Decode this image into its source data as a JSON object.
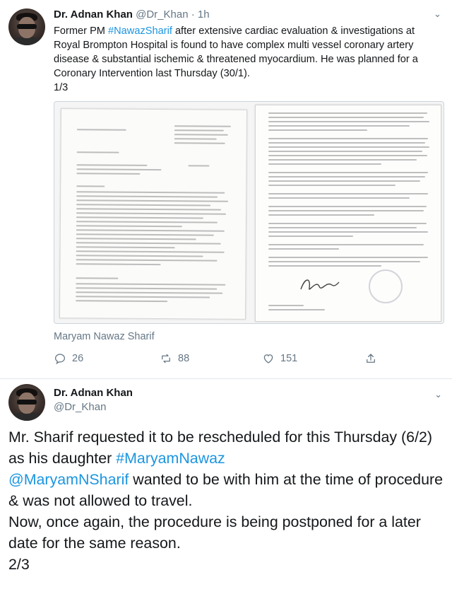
{
  "tweet1": {
    "name": "Dr. Adnan Khan",
    "handle": "@Dr_Khan",
    "time": "1h",
    "text_pre": "Former PM ",
    "hashtag": "#NawazSharif",
    "text_post": " after extensive cardiac evaluation & investigations at Royal Brompton Hospital is found to have complex multi vessel coronary artery disease & substantial ischemic & threatened myocardium. He was planned for a Coronary Intervention last Thursday (30/1).",
    "count": "1/3",
    "media_caption": "Maryam Nawaz Sharif",
    "replies": "26",
    "retweets": "88",
    "likes": "151"
  },
  "tweet2": {
    "name": "Dr. Adnan Khan",
    "handle": "@Dr_Khan",
    "text_a": "Mr. Sharif requested it to be rescheduled for this Thursday (6/2) as his daughter ",
    "hashtag": "#MaryamNawaz",
    "mention": "@MaryamNSharif",
    "text_b": " wanted to be with him at the time of procedure & was not allowed to travel.",
    "text_c": "Now, once again, the procedure is being postponed for a later date for the same reason.",
    "count": "2/3"
  },
  "icons": {
    "reply": "reply-icon",
    "retweet": "retweet-icon",
    "like": "heart-icon",
    "share": "share-icon",
    "menu": "chevron-down-icon"
  },
  "colors": {
    "link": "#1b95e0",
    "secondary": "#657786",
    "text": "#14171a"
  }
}
